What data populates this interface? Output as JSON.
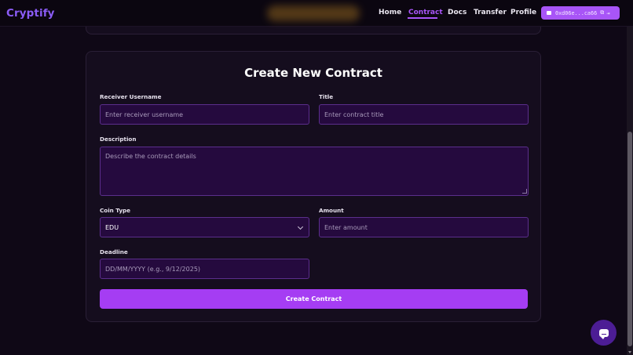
{
  "app": {
    "name": "Cryptify"
  },
  "nav": {
    "items": [
      {
        "label": "Home",
        "active": false
      },
      {
        "label": "Contract",
        "active": true
      },
      {
        "label": "Docs",
        "active": false
      },
      {
        "label": "Transfer",
        "active": false
      },
      {
        "label": "Profile",
        "active": false
      }
    ],
    "wallet_address": "0xd06e...ca66"
  },
  "form": {
    "title": "Create New Contract",
    "receiver": {
      "label": "Receiver Username",
      "placeholder": "Enter receiver username",
      "value": ""
    },
    "title_field": {
      "label": "Title",
      "placeholder": "Enter contract title",
      "value": ""
    },
    "description": {
      "label": "Description",
      "placeholder": "Describe the contract details",
      "value": ""
    },
    "coin_type": {
      "label": "Coin Type",
      "selected": "EDU"
    },
    "amount": {
      "label": "Amount",
      "placeholder": "Enter amount",
      "value": ""
    },
    "deadline": {
      "label": "Deadline",
      "placeholder": "DD/MM/YYYY (e.g., 9/12/2025)",
      "value": ""
    },
    "submit_label": "Create Contract"
  },
  "colors": {
    "accent": "#a855f7",
    "background": "#0f0816",
    "card": "#150d1e",
    "input_bg": "#250a3e",
    "input_border": "#5b2e8c",
    "button": "#a53df3"
  },
  "icons": {
    "wallet": "wallet-icon",
    "copy": "copy-icon",
    "logout": "logout-icon",
    "chevron": "chevron-down-icon",
    "chat": "chat-icon"
  }
}
